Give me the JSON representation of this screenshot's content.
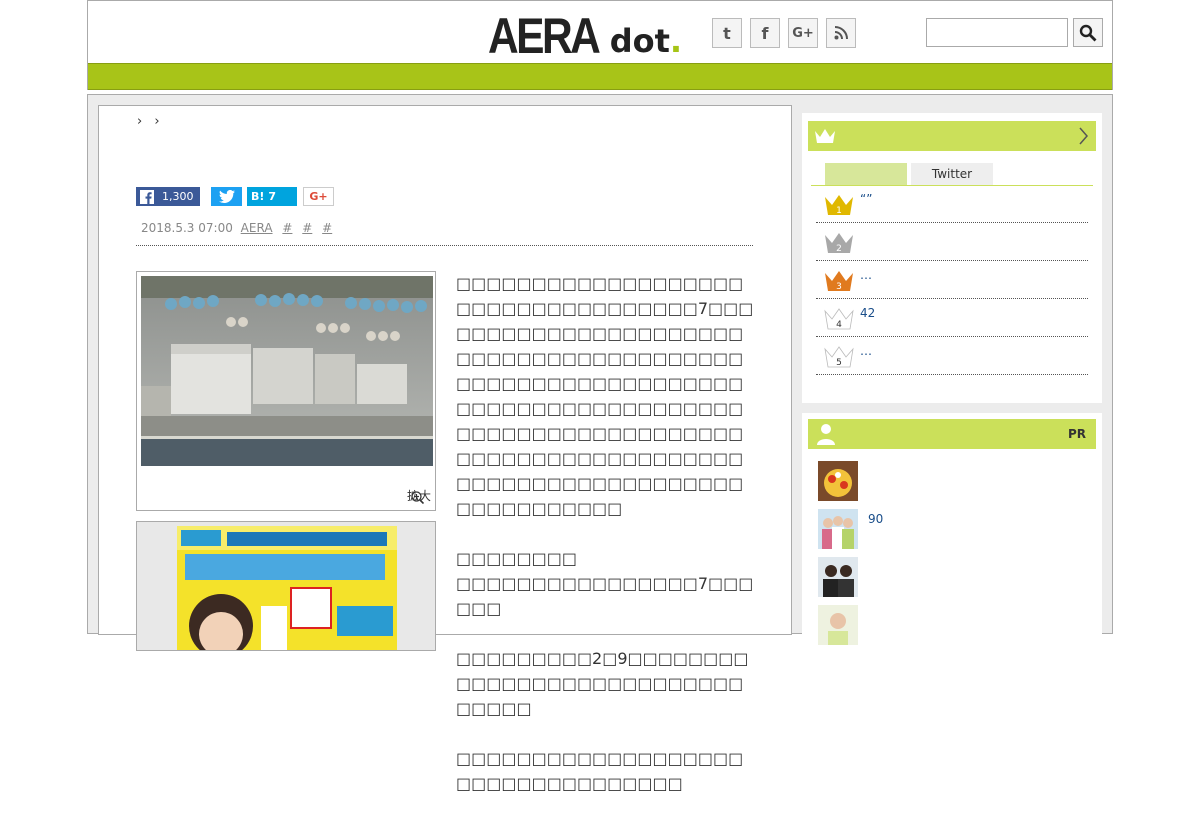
{
  "header": {
    "logo_main": "AERA",
    "logo_sub": "dot",
    "logo_period": ".",
    "social": [
      {
        "name": "twitter-icon",
        "glyph": "t"
      },
      {
        "name": "facebook-icon",
        "glyph": "f"
      },
      {
        "name": "google-plus-icon",
        "glyph": "G+"
      },
      {
        "name": "rss-icon",
        "glyph": "≋"
      }
    ],
    "search_placeholder": ""
  },
  "breadcrumb": [
    "›",
    "›"
  ],
  "share": {
    "facebook_count": "1,300",
    "hatena_label": "B!",
    "hatena_count": "7",
    "gplus_label": "G+"
  },
  "meta": {
    "date": "2018.5.3 07:00",
    "source": "AERA",
    "tags": [
      "#",
      "#",
      "#"
    ]
  },
  "photo": {
    "zoom_label": "拡大"
  },
  "article": {
    "paragraphs": [
      "□□□□□□□□□□□□□□□□□□□□□□□□□□□□□□□□□□□7□□□□□□□□□□□□□□□□□□□□□□□□□□□□□□□□□□□□□□□□□□□□□□□□□□□□□□□□□□□□□□□□□□□□□□□□□□□□□□□□□□□□□□□□□□□□□□□□□□□□□□□□□□□□□□□□□□□□□□□□□□□□□□□□□□□□□□□□□□□□□□□□□□□",
      "□□□□□□□□\n□□□□□□□□□□□□□□□□7□□□□□□",
      "□□□□□□□□□2□9□□□□□□□□□□□□□□□□□□□□□□□□□□□□□□□□",
      "□□□□□□□□□□□□□□□□□□□□□□□□□□□□□□□□□□"
    ]
  },
  "ranking": {
    "tabs": [
      "",
      "Twitter"
    ],
    "items": [
      {
        "rank": "1",
        "text": "“”",
        "color": "#e0b800"
      },
      {
        "rank": "2",
        "text": "",
        "color": "#a8a8a8"
      },
      {
        "rank": "3",
        "text": "…",
        "color": "#e07a1f"
      },
      {
        "rank": "4",
        "text": "42",
        "color": "#ffffff"
      },
      {
        "rank": "5",
        "text": "…",
        "color": "#ffffff"
      }
    ]
  },
  "pr": {
    "label": "PR",
    "items": [
      {
        "text": ""
      },
      {
        "text": "90"
      },
      {
        "text": ""
      },
      {
        "text": ""
      }
    ]
  },
  "colors": {
    "accent": "#a8c418",
    "accent_light": "#cbe05a",
    "link": "#1a4e8a"
  }
}
